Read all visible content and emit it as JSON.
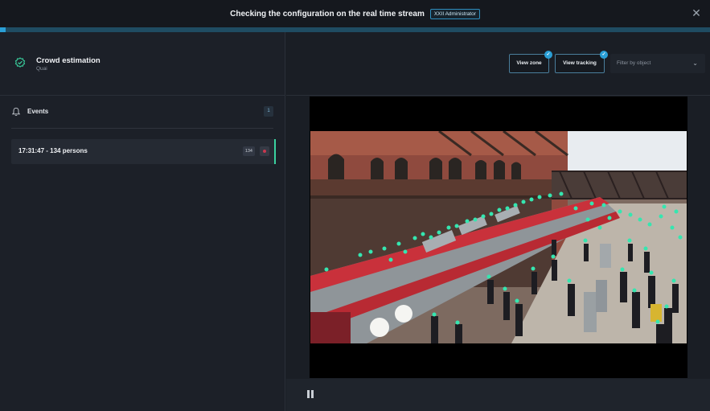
{
  "header": {
    "title": "Checking the configuration on the real time stream",
    "role_badge": "XXII Administrator",
    "close_icon": "close-icon"
  },
  "stream_progress": {
    "percent": 0.8
  },
  "zone": {
    "title": "Crowd estimation",
    "subtitle": "Quai",
    "icon": "crowd-check-icon",
    "accent_color": "#3ad29f"
  },
  "events": {
    "label": "Events",
    "count": "1",
    "icon": "bell-icon",
    "items": [
      {
        "text": "17:31:47  -  134 persons",
        "badge": "134",
        "status_color": "#c8384f"
      }
    ]
  },
  "toolbar": {
    "view_zone_label": "View zone",
    "view_tracking_label": "View tracking",
    "filter_placeholder": "Filter by object",
    "check_icon": "check-icon",
    "chevron_icon": "chevron-down-icon"
  },
  "player": {
    "pause_icon": "pause-icon"
  },
  "colors": {
    "accent": "#2a9fd6",
    "detection": "#35e6b0"
  }
}
